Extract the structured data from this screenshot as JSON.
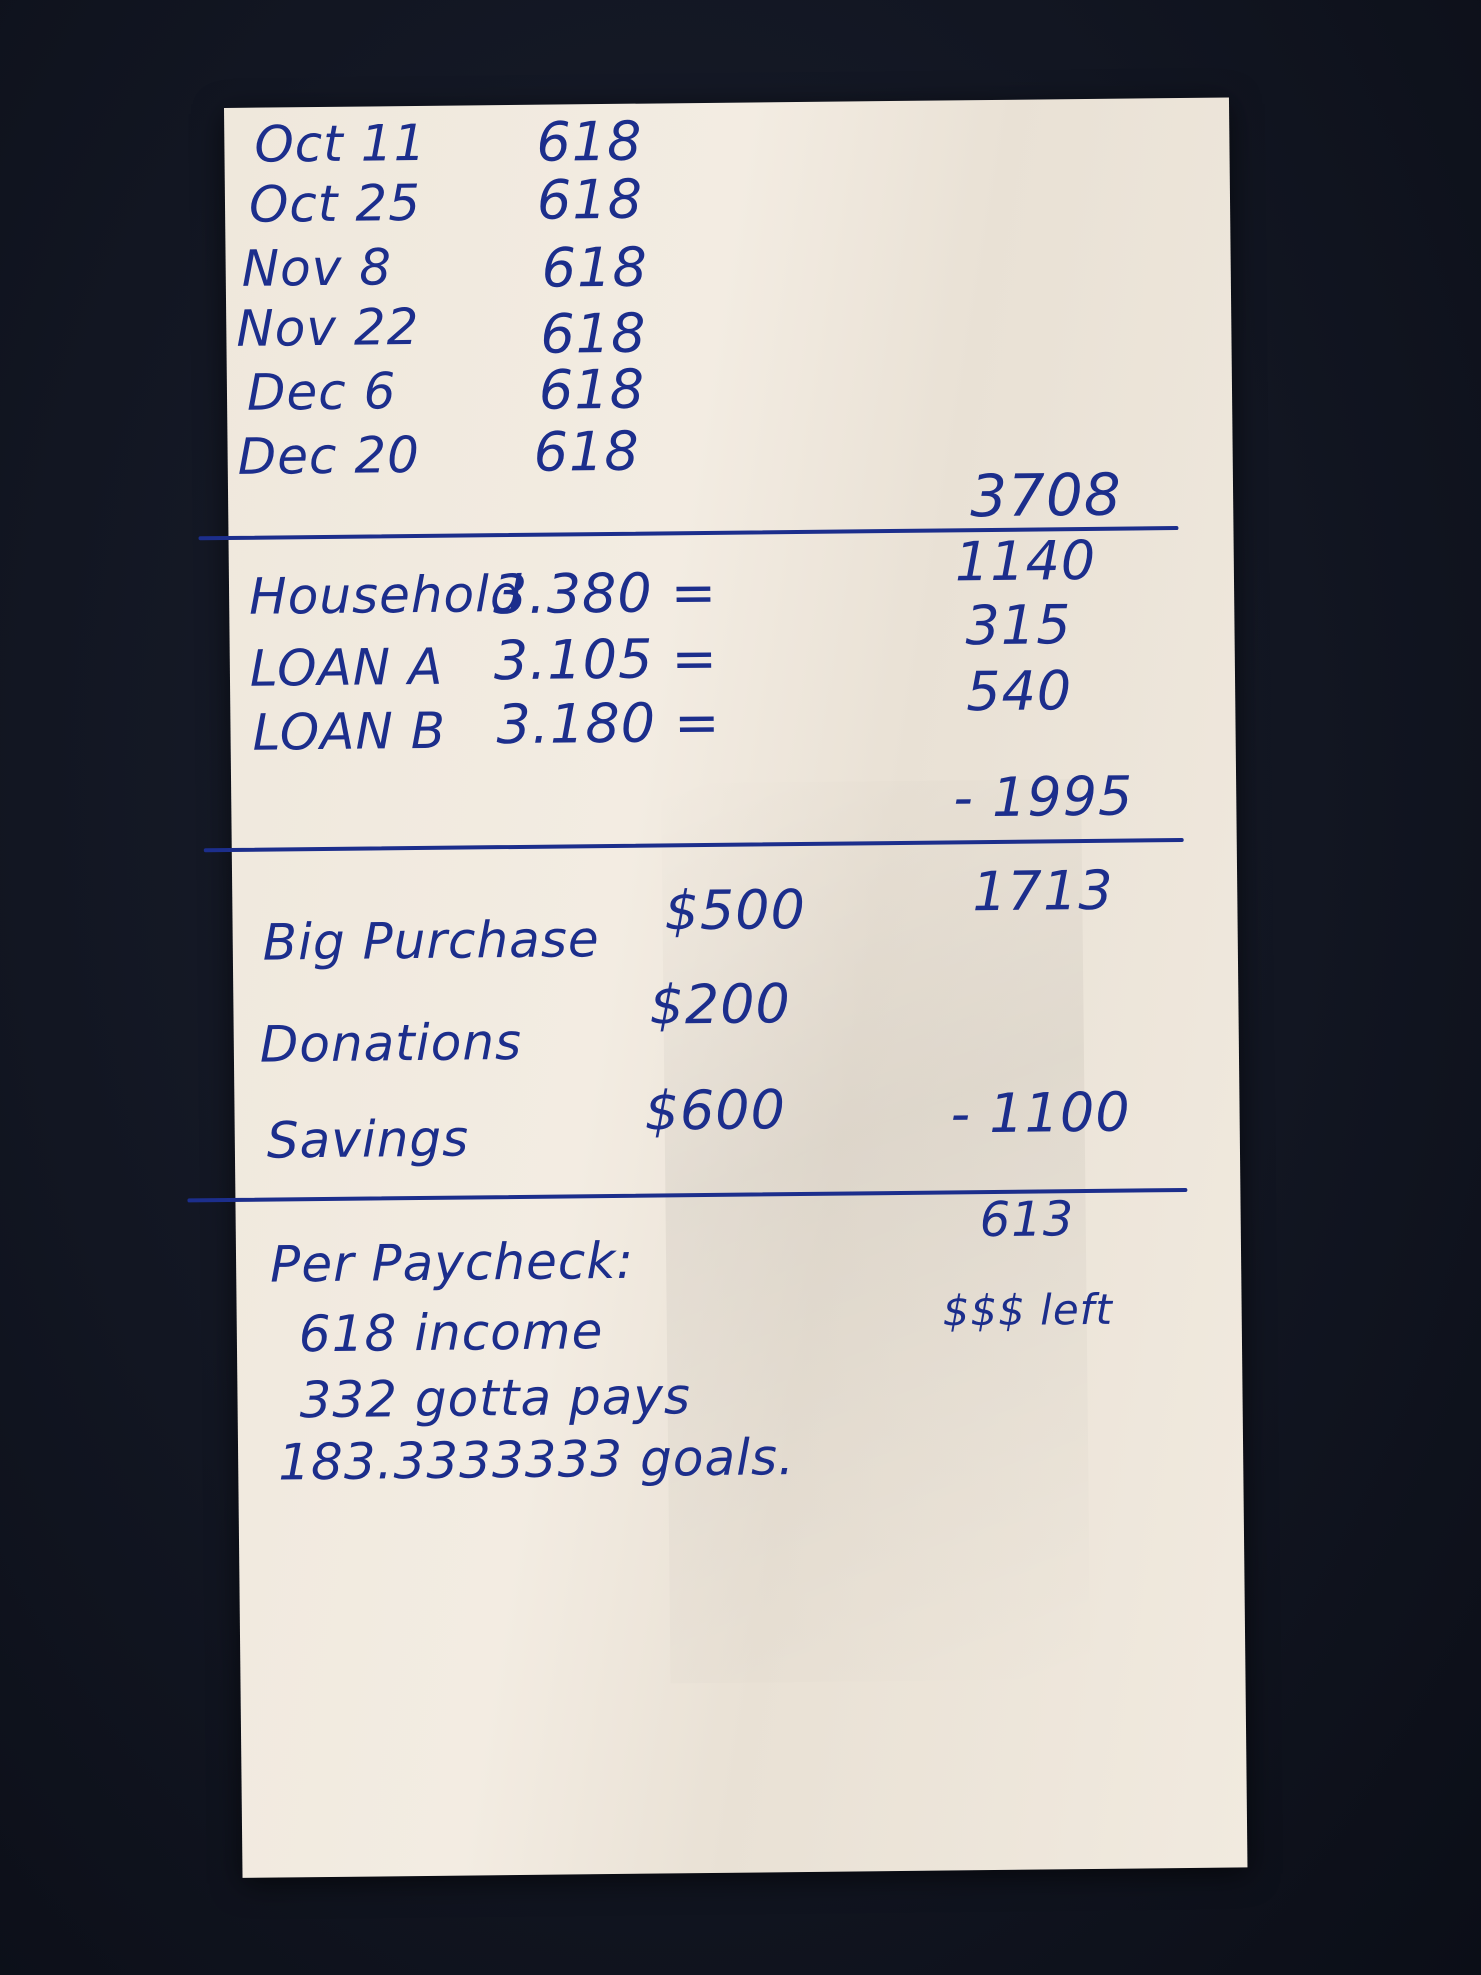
{
  "paychecks": [
    {
      "date": "Oct 11",
      "amount": "618"
    },
    {
      "date": "Oct 25",
      "amount": "618"
    },
    {
      "date": "Nov 8",
      "amount": "618"
    },
    {
      "date": "Nov 22",
      "amount": "618"
    },
    {
      "date": "Dec 6",
      "amount": "618"
    },
    {
      "date": "Dec 20",
      "amount": "618"
    }
  ],
  "income_total": "3708",
  "bills": [
    {
      "label": "Household",
      "calc": "3.380 =",
      "amount": "1140"
    },
    {
      "label": "LOAN A",
      "calc": "3.105 =",
      "amount": "315"
    },
    {
      "label": "LOAN B",
      "calc": "3.180 =",
      "amount": "540"
    }
  ],
  "bills_total": "- 1995",
  "after_bills": "1713",
  "goals": [
    {
      "label": "Big Purchase",
      "amount": "$500"
    },
    {
      "label": "Donations",
      "amount": "$200"
    },
    {
      "label": "Savings",
      "amount": "$600"
    }
  ],
  "goals_total": "- 1100",
  "remaining": "613",
  "remaining_note": "$$$ left",
  "per_paycheck": {
    "title": "Per Paycheck:",
    "lines": [
      "618 income",
      "332 gotta pays",
      "183.3333333 goals."
    ]
  }
}
